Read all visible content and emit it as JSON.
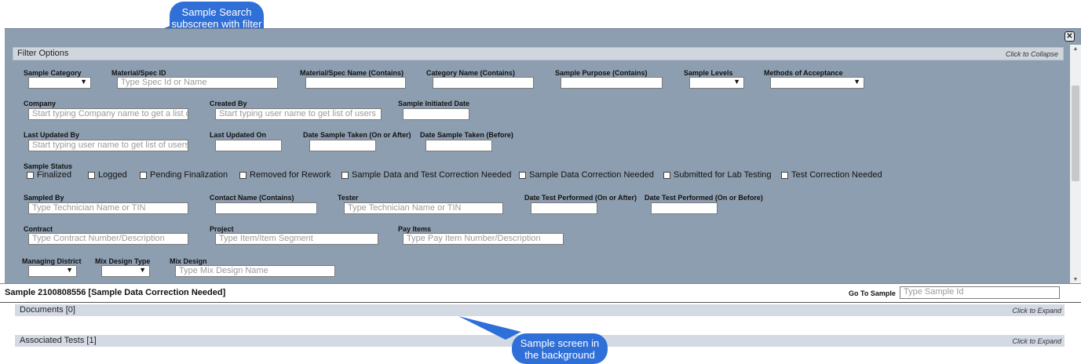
{
  "callouts": {
    "top": "Sample Search subscreen with filter options",
    "bottom": "Sample screen in the background"
  },
  "modal": {
    "close_icon": "close-icon",
    "filter_panel": {
      "title": "Filter Options",
      "toggle_hint": "Click to Collapse"
    },
    "labels": {
      "sample_category": "Sample Category",
      "material_spec_id": "Material/Spec ID",
      "material_spec_name": "Material/Spec Name (Contains)",
      "category_name": "Category Name (Contains)",
      "sample_purpose": "Sample Purpose (Contains)",
      "sample_levels": "Sample Levels",
      "methods_of_acceptance": "Methods of Acceptance",
      "company": "Company",
      "created_by": "Created By",
      "sample_initiated_date": "Sample Initiated Date",
      "last_updated_by": "Last Updated By",
      "last_updated_on": "Last Updated On",
      "date_taken_after": "Date Sample Taken (On or After)",
      "date_taken_before": "Date Sample Taken (Before)",
      "sample_status": "Sample Status",
      "sampled_by": "Sampled By",
      "contact_name": "Contact Name (Contains)",
      "tester": "Tester",
      "date_test_after": "Date Test Performed (On or After)",
      "date_test_before": "Date Test Performed (On or Before)",
      "contract": "Contract",
      "project": "Project",
      "pay_items": "Pay Items",
      "managing_district": "Managing District",
      "mix_design_type": "Mix Design Type",
      "mix_design": "Mix Design"
    },
    "placeholders": {
      "spec_id": "Type Spec Id or Name",
      "company": "Start typing Company name to get a list of",
      "created_by": "Start typing user name to get list of users",
      "last_updated_by": "Start typing user name to get list of users",
      "sampled_by": "Type Technician Name or TIN",
      "tester": "Type Technician Name or TIN",
      "contract": "Type Contract Number/Description",
      "project": "Type Item/Item Segment",
      "pay_items": "Type Pay Item Number/Description",
      "mix_design": "Type Mix Design Name"
    },
    "statuses": [
      "Finalized",
      "Logged",
      "Pending Finalization",
      "Removed for Rework",
      "Sample Data and Test Correction Needed",
      "Sample Data Correction Needed",
      "Submitted for Lab Testing",
      "Test Correction Needed"
    ]
  },
  "background": {
    "sample_title": "Sample 2100808556 [Sample Data Correction Needed]",
    "go_to_label": "Go To Sample",
    "go_to_placeholder": "Type Sample Id",
    "sections": [
      {
        "title": "Documents [0]",
        "hint": "Click to Expand"
      },
      {
        "title": "Associated Tests [1]",
        "hint": "Click to Expand"
      }
    ]
  }
}
